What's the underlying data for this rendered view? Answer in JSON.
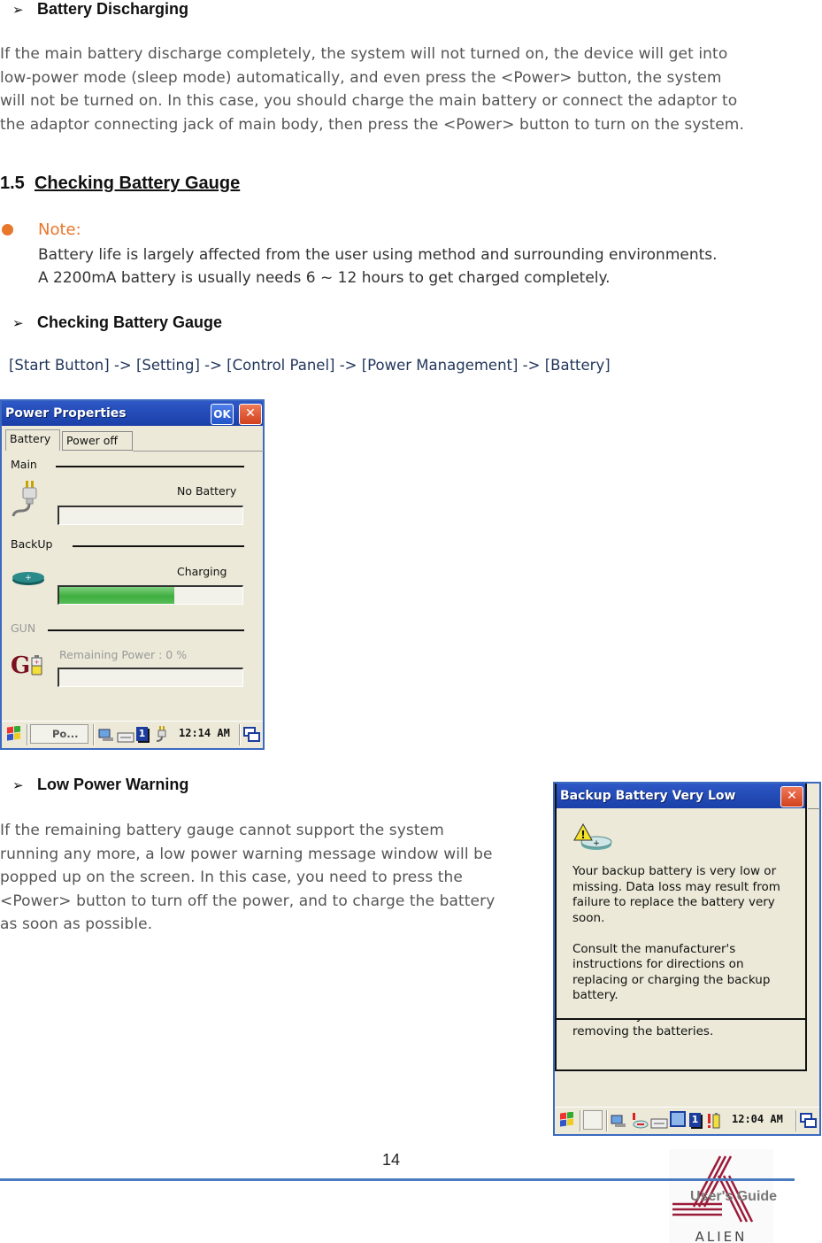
{
  "sections": {
    "discharging": {
      "heading": "Battery Discharging",
      "paragraph_lines": [
        "If the main battery discharge completely, the system will not turned on, the device will get into",
        "low-power mode (sleep mode) automatically, and even press the <Power> button, the system",
        "will not be turned on. In this case, you should charge the main battery or connect the adaptor to",
        "the adaptor connecting jack of main body, then press the <Power> button to turn on the system."
      ]
    },
    "gauge": {
      "number": "1.5",
      "title": "Checking Battery Gauge",
      "note_label": "Note:",
      "note_lines": [
        "Battery life is largely affected from the user using method and surrounding environments.",
        "A 2200mA battery is usually needs 6 ~ 12 hours to get charged completely."
      ],
      "sub_heading": "Checking Battery Gauge",
      "nav_path": "[Start Button] -> [Setting] -> [Control Panel] -> [Power Management] -> [Battery]"
    },
    "low_power": {
      "heading": "Low Power Warning",
      "paragraph_lines": [
        "If the remaining battery gauge cannot support the system",
        "running any more, a low power warning message window will be",
        "popped up on the screen. In this case, you need to press the",
        "<Power> button to turn off the power, and to charge the battery",
        "as soon as possible."
      ]
    }
  },
  "power_properties": {
    "title": "Power Properties",
    "ok_label": "OK",
    "close_label": "✕",
    "tabs": [
      "Battery",
      "Power off"
    ],
    "main": {
      "label": "Main",
      "status": "No Battery",
      "level_percent": 0
    },
    "backup": {
      "label": "BackUp",
      "status": "Charging",
      "level_percent": 63
    },
    "gun": {
      "label": "GUN",
      "status": "Remaining Power : 0 %",
      "level_percent": 0
    },
    "taskbar": {
      "task_label": "Po...",
      "clock": "12:14 AM",
      "input_indicator": "1"
    }
  },
  "backup_warning": {
    "title": "Backup Battery Very Low",
    "close_label": "✕",
    "message_lines_1": [
      "Your backup battery is very low or",
      "missing. Data loss may result from",
      "failure to replace the battery very",
      "soon."
    ],
    "message_lines_2": [
      "Consult the manufacturer's",
      "instructions for directions on",
      "replacing or charging the backup",
      "battery."
    ],
    "behind_lines": [
      "to turn off your device before",
      "removing the batteries."
    ],
    "taskbar": {
      "clock": "12:04 AM",
      "input_indicator": "1"
    }
  },
  "footer": {
    "page_number": "14",
    "guide_label": "User's Guide",
    "brand": "ALIEN"
  },
  "colors": {
    "accent_orange": "#e8762b",
    "path_blue": "#22375c",
    "rule_blue": "#4a7bbf",
    "logo_red": "#9b1b3a"
  }
}
